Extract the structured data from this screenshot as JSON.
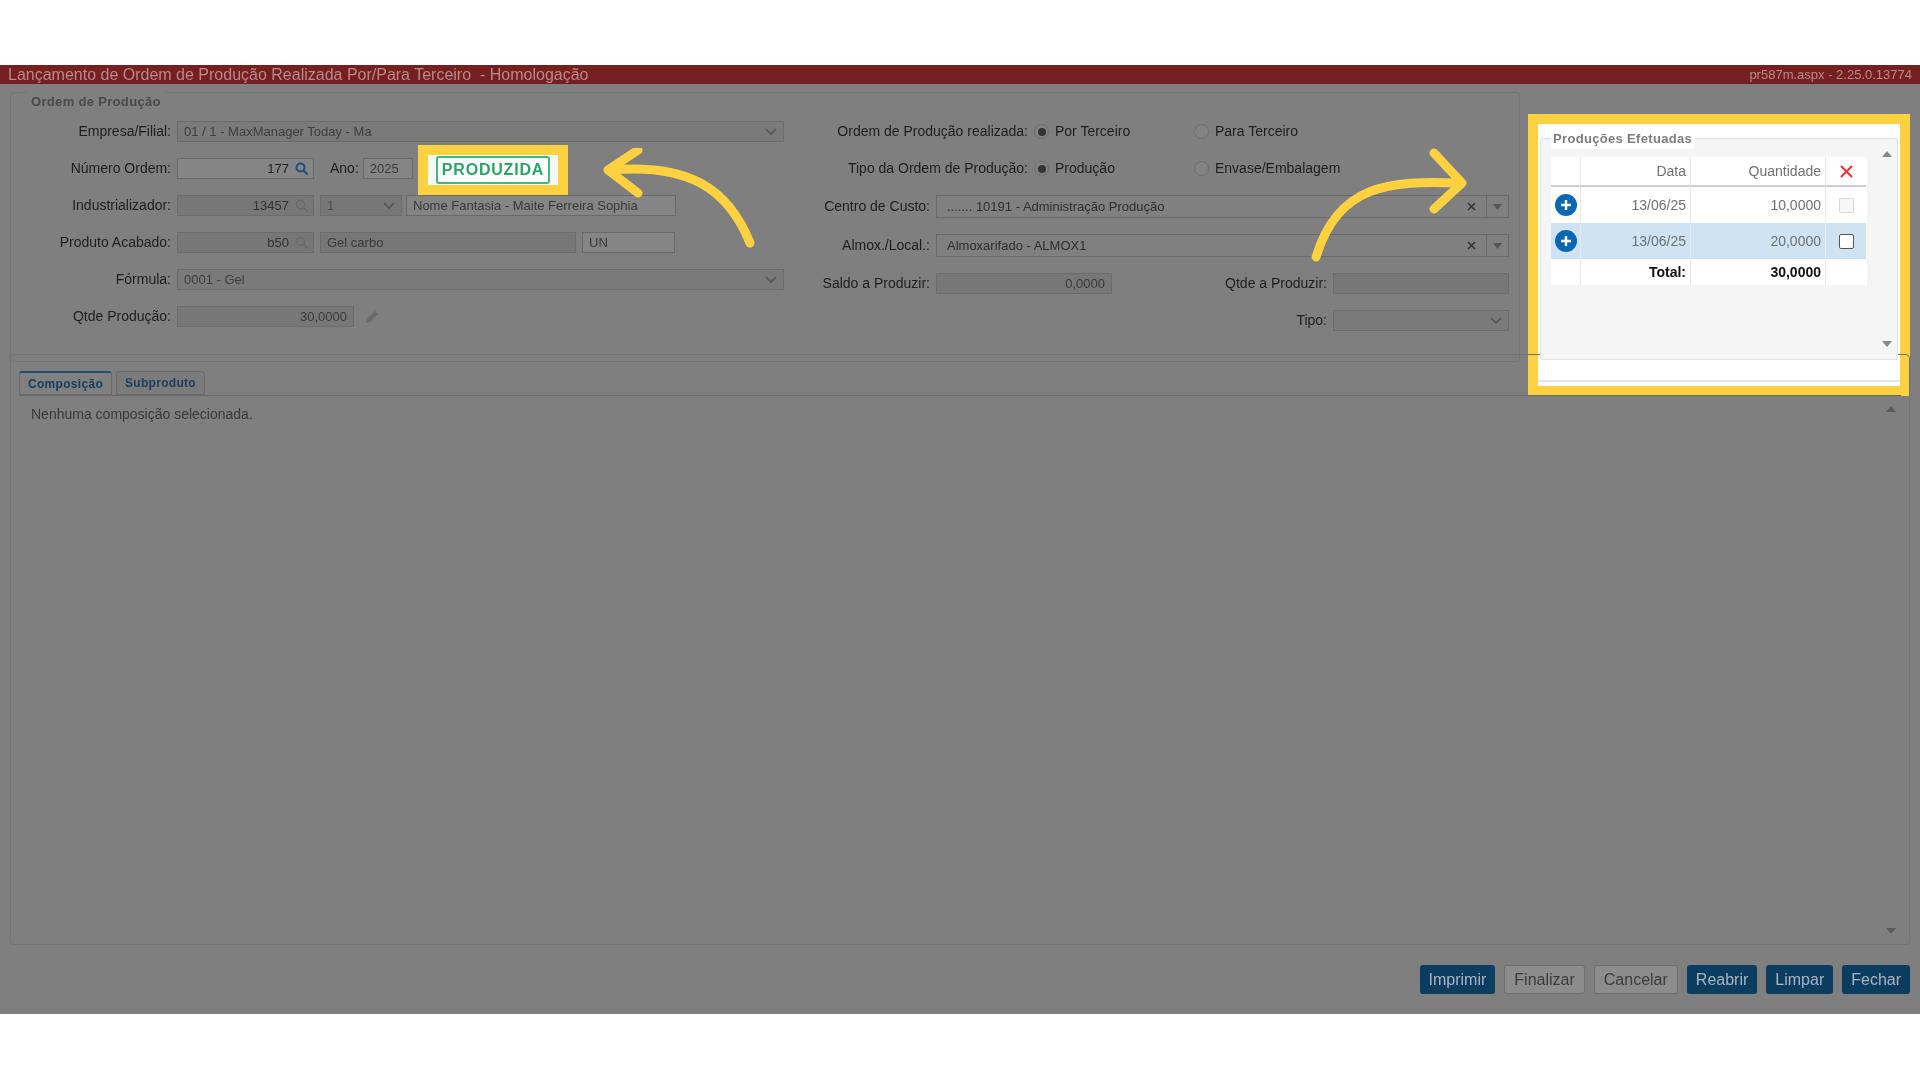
{
  "title_bar": {
    "title": "Lançamento de Ordem de Produção Realizada Por/Para Terceiro  - Homologação",
    "version": "pr587m.aspx - 2.25.0.13774"
  },
  "ordem": {
    "legend": "Ordem de Produção",
    "empresa": {
      "label": "Empresa/Filial:",
      "value": "01 / 1 - MaxManager Today - Ma"
    },
    "numero": {
      "label": "Número Ordem:",
      "value": "177"
    },
    "ano": {
      "label": "Ano:",
      "value": "2025"
    },
    "status": "PRODUZIDA",
    "industrializador": {
      "label": "Industrializador:",
      "value": "13457",
      "select": "1",
      "nome": "Nome Fantasia - Maite Ferreira Sophia"
    },
    "produto": {
      "label": "Produto Acabado:",
      "value": "b50",
      "descricao": "Gel carbo",
      "unidade": "UN"
    },
    "formula": {
      "label": "Fórmula:",
      "value": "0001 - Gel"
    },
    "qtde": {
      "label": "Qtde Produção:",
      "value": "30,0000"
    },
    "realizada": {
      "label": "Ordem de Produção realizada:",
      "options": [
        {
          "label": "Por Terceiro",
          "selected": true
        },
        {
          "label": "Para Terceiro",
          "selected": false
        }
      ]
    },
    "tipo_ordem": {
      "label": "Tipo da Ordem de Produção:",
      "options": [
        {
          "label": "Produção",
          "selected": true
        },
        {
          "label": "Envase/Embalagem",
          "selected": false
        }
      ]
    },
    "centro": {
      "label": "Centro de Custo:",
      "value": "....... 10191 - Administração Produção"
    },
    "almox": {
      "label": "Almox./Local.:",
      "value": "Almoxarifado - ALMOX1"
    },
    "saldo": {
      "label": "Saldo a Produzir:",
      "value": "0,0000"
    },
    "qtde_produzir": {
      "label": "Qtde a Produzir:"
    },
    "tipo": {
      "label": "Tipo:"
    }
  },
  "producoes": {
    "legend": "Produções Efetuadas",
    "columns": [
      "Data",
      "Quantidade"
    ],
    "rows": [
      {
        "data": "13/06/25",
        "quantidade": "10,0000",
        "selected": false,
        "checked": false,
        "disabled": true
      },
      {
        "data": "13/06/25",
        "quantidade": "20,0000",
        "selected": true,
        "checked": false,
        "disabled": false
      }
    ],
    "total_label": "Total:",
    "total": "30,0000"
  },
  "tabs": [
    {
      "label": "Composição",
      "selected": true
    },
    {
      "label": "Subproduto",
      "selected": false
    }
  ],
  "tab_content": "Nenhuma composição selecionada.",
  "buttons": [
    {
      "label": "Imprimir",
      "disabled": false
    },
    {
      "label": "Finalizar",
      "disabled": true
    },
    {
      "label": "Cancelar",
      "disabled": true
    },
    {
      "label": "Reabrir",
      "disabled": false
    },
    {
      "label": "Limpar",
      "disabled": false
    },
    {
      "label": "Fechar",
      "disabled": false
    }
  ]
}
